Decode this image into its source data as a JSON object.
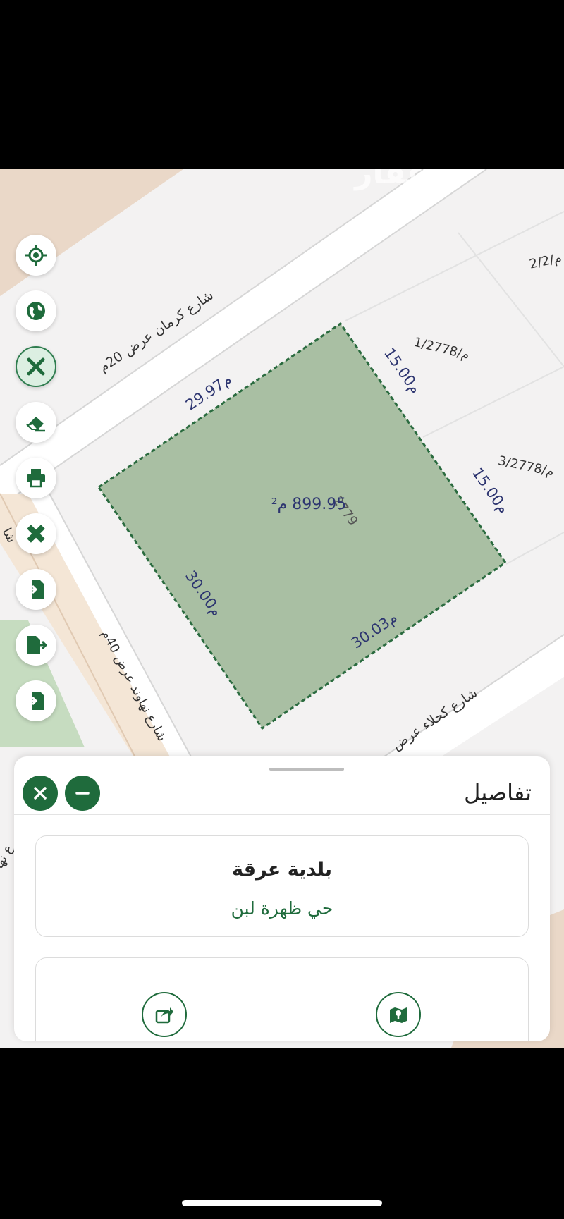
{
  "map": {
    "streets": {
      "north": "شارع كرمان عرض 20م",
      "west": "شارع نهاوند عرض 40م",
      "south": "شارع كحلاء عرض",
      "west_partial": "شا",
      "west_lower_partial": "ع نها"
    },
    "parcel": {
      "number": "2779",
      "area": "899.95 م²",
      "sides": {
        "north": "29.97م",
        "east": "15.00م",
        "east2": "15.00م",
        "west": "30.00م",
        "south": "30.03م"
      }
    },
    "neighbor_parcels": [
      "2/م/2",
      "1/م/2778",
      "3/م/2778"
    ],
    "watermark": "عقار"
  },
  "toolbar": {
    "icons": [
      "locate-icon",
      "globe-icon",
      "tools-icon",
      "eraser-icon",
      "print-icon",
      "measure-icon",
      "import-icon",
      "export-icon",
      "login-icon"
    ]
  },
  "panel": {
    "title": "تفاصيل",
    "municipality": "بلدية عرقة",
    "district": "حي ظهرة لبن"
  },
  "colors": {
    "accent": "#1f6b3c",
    "parcel_fill": "#a9bfa3",
    "parcel_border": "#2a6b3f",
    "label_text": "#2d3570"
  }
}
